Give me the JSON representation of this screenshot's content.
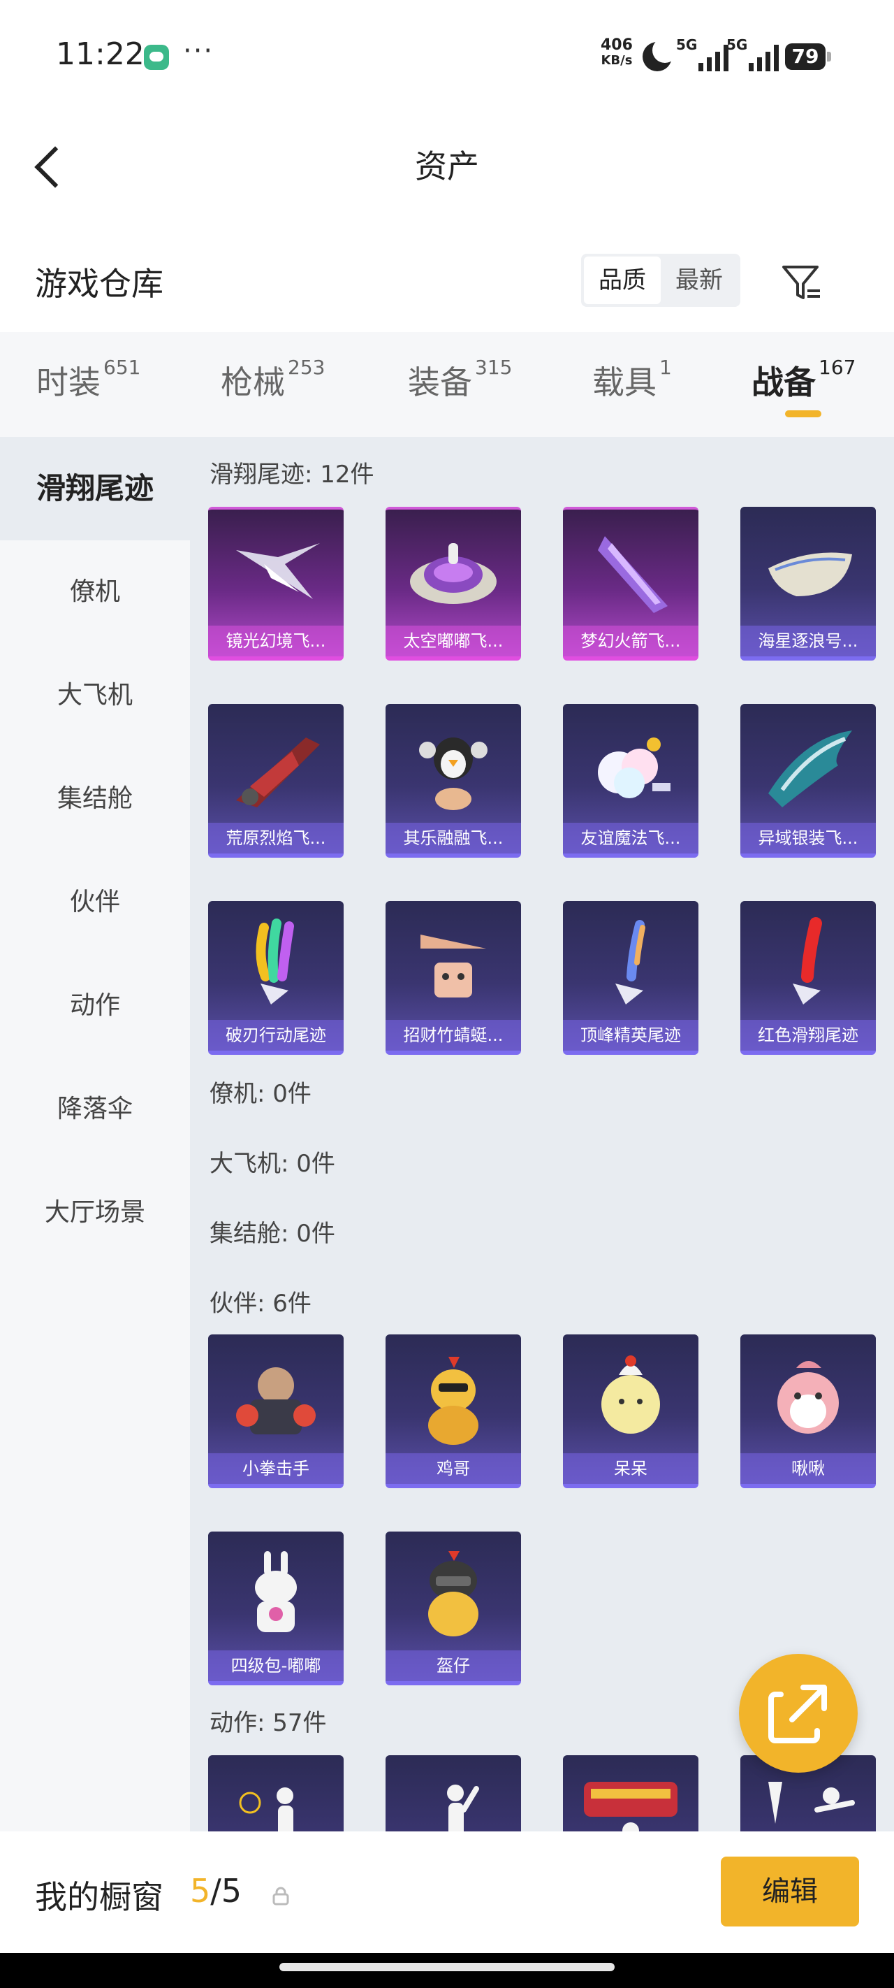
{
  "status_bar": {
    "time": "11:22",
    "speed_value": "406",
    "speed_unit": "KB/s",
    "net1": "5G",
    "net2": "5G",
    "battery": "79",
    "more": "···"
  },
  "header": {
    "title": "资产"
  },
  "warehouse": {
    "title": "游戏仓库",
    "sort_options": [
      "品质",
      "最新"
    ],
    "active_sort": "品质"
  },
  "tabs": [
    {
      "label": "时装",
      "count": "651"
    },
    {
      "label": "枪械",
      "count": "253"
    },
    {
      "label": "装备",
      "count": "315"
    },
    {
      "label": "载具",
      "count": "1"
    },
    {
      "label": "战备",
      "count": "167"
    }
  ],
  "active_tab": "战备",
  "side_menu": [
    "滑翔尾迹",
    "僚机",
    "大飞机",
    "集结舱",
    "伙伴",
    "动作",
    "降落伞",
    "大厅场景"
  ],
  "active_side": "滑翔尾迹",
  "sections": {
    "glide": {
      "title": "滑翔尾迹: 12件",
      "items": [
        "镜光幻境飞...",
        "太空嘟嘟飞...",
        "梦幻火箭飞...",
        "海星逐浪号...",
        "荒原烈焰飞...",
        "其乐融融飞...",
        "友谊魔法飞...",
        "异域银装飞...",
        "破刃行动尾迹",
        "招财竹蜻蜓...",
        "顶峰精英尾迹",
        "红色滑翔尾迹"
      ]
    },
    "wingman": {
      "title": "僚机: 0件"
    },
    "plane": {
      "title": "大飞机: 0件"
    },
    "pod": {
      "title": "集结舱: 0件"
    },
    "partner": {
      "title": "伙伴: 6件",
      "items": [
        "小拳击手",
        "鸡哥",
        "呆呆",
        "啾啾",
        "四级包-嘟嘟",
        "盔仔"
      ]
    },
    "action": {
      "title": "动作: 57件"
    }
  },
  "bottom": {
    "label": "我的橱窗",
    "current": "5",
    "sep_total": "/5",
    "edit": "编辑"
  },
  "colors": {
    "accent": "#f2b42a",
    "card_purple": "#5a4fa8",
    "card_pink": "#b04ac8"
  }
}
